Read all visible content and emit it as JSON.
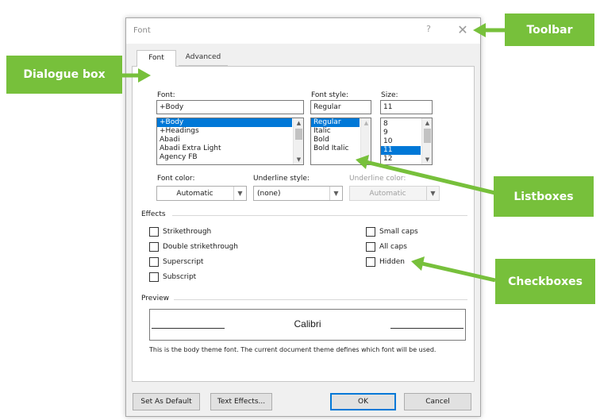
{
  "dialog": {
    "title": "Font",
    "help": "?",
    "close": "✕",
    "tabs": [
      {
        "label": "Font",
        "active": true
      },
      {
        "label": "Advanced",
        "active": false
      }
    ],
    "font": {
      "label": "Font:",
      "value": "+Body",
      "items": [
        "+Body",
        "+Headings",
        "Abadi",
        "Abadi Extra Light",
        "Agency FB"
      ],
      "selected": "+Body"
    },
    "style": {
      "label": "Font style:",
      "value": "Regular",
      "items": [
        "Regular",
        "Italic",
        "Bold",
        "Bold Italic"
      ],
      "selected": "Regular"
    },
    "size": {
      "label": "Size:",
      "value": "11",
      "items": [
        "8",
        "9",
        "10",
        "11",
        "12"
      ],
      "selected": "11"
    },
    "font_color": {
      "label": "Font color:",
      "value": "Automatic"
    },
    "underline_style": {
      "label": "Underline style:",
      "value": "(none)"
    },
    "underline_color": {
      "label": "Underline color:",
      "value": "Automatic"
    },
    "effects": {
      "label": "Effects",
      "items": [
        {
          "label": "Strikethrough",
          "checked": false
        },
        {
          "label": "Double strikethrough",
          "checked": false
        },
        {
          "label": "Superscript",
          "checked": false
        },
        {
          "label": "Subscript",
          "checked": false
        },
        {
          "label": "Small caps",
          "checked": false
        },
        {
          "label": "All caps",
          "checked": false
        },
        {
          "label": "Hidden",
          "checked": false
        }
      ]
    },
    "preview": {
      "label": "Preview",
      "sample": "Calibri",
      "description": "This is the body theme font. The current document theme defines which font will be used."
    },
    "buttons": {
      "set_default": "Set As Default",
      "text_effects": "Text Effects...",
      "ok": "OK",
      "cancel": "Cancel"
    }
  },
  "annotations": {
    "toolbar": "Toolbar",
    "dialogue_box": "Dialogue box",
    "listboxes": "Listboxes",
    "checkboxes": "Checkboxes",
    "color": "#77c03b"
  }
}
